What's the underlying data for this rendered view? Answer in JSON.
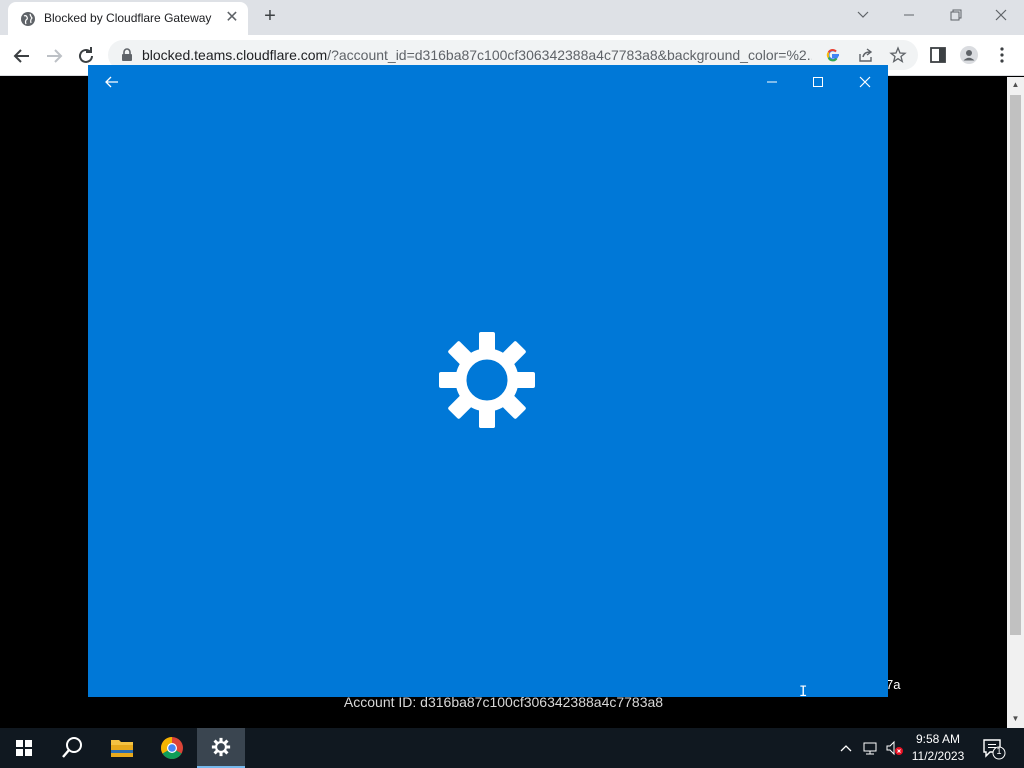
{
  "browser": {
    "tab_title": "Blocked by Cloudflare Gateway",
    "tab_close": "✕",
    "new_tab": "+",
    "url_host": "blocked.teams.cloudflare.com",
    "url_rest": "/?account_id=d316ba87c100cf306342388a4c7783a8&background_color=%2..."
  },
  "page": {
    "account_line": "Account ID: d316ba87c100cf306342388a4c7783a8",
    "partial_text": "7a"
  },
  "fake_window": {
    "background_color": "#0078d7",
    "icon": "gear-icon"
  },
  "taskbar": {
    "time": "9:58 AM",
    "date": "11/2/2023",
    "notification_count": "1"
  }
}
